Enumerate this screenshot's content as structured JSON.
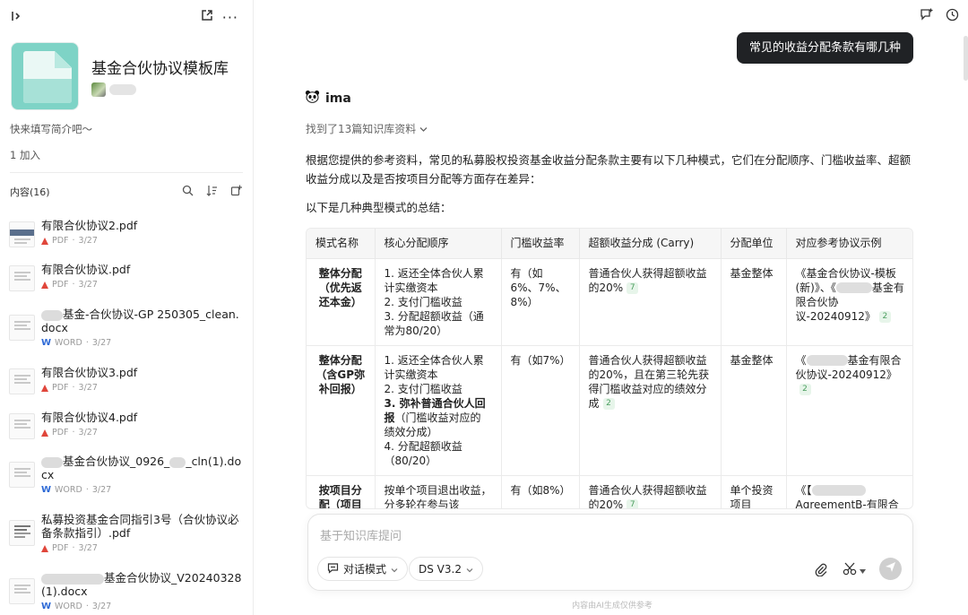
{
  "sidebar": {
    "knowledge_base_title": "基金合伙协议模板库",
    "intro_placeholder": "快来填写简介吧～",
    "members": "1 加入",
    "content_label": "内容(16)",
    "files": [
      {
        "name": "有限合伙协议2.pdf",
        "type": "PDF",
        "date": "3/27"
      },
      {
        "name": "有限合伙协议.pdf",
        "type": "PDF",
        "date": "3/27"
      },
      {
        "name_suffix": "基金-合伙协议-GP 250305_clean.docx",
        "type": "WORD",
        "date": "3/27"
      },
      {
        "name": "有限合伙协议3.pdf",
        "type": "PDF",
        "date": "3/27"
      },
      {
        "name": "有限合伙协议4.pdf",
        "type": "PDF",
        "date": "3/27"
      },
      {
        "name_part1": "基金合伙协议_0926_",
        "name_part2": "_cln(1).docx",
        "type": "WORD",
        "date": "3/27"
      },
      {
        "name": "私募投资基金合同指引3号（合伙协议必备条款指引）.pdf",
        "type": "PDF",
        "date": "3/27"
      },
      {
        "name_suffix": "基金合伙协议_V20240328(1).docx",
        "type": "WORD",
        "date": "3/27"
      }
    ]
  },
  "chat": {
    "question": "常见的收益分配条款有哪几种",
    "bot_name": "ima",
    "found_refs": "找到了13篇知识库资料",
    "answer_intro": "根据您提供的参考资料，常见的私募股权投资基金收益分配条款主要有以下几种模式，它们在分配顺序、门槛收益率、超额收益分成以及是否按项目分配等方面存在差异：",
    "summary_intro": "以下是几种典型模式的总结：",
    "table": {
      "headers": [
        "模式名称",
        "核心分配顺序",
        "门槛收益率",
        "超额收益分成 (Carry)",
        "分配单位",
        "对应参考协议示例"
      ],
      "rows": [
        {
          "name": "整体分配（优先返还本金）",
          "order": [
            "1. 返还全体合伙人累计实缴资本",
            "2. 支付门槛收益",
            "3. 分配超额收益（通常为80/20）"
          ],
          "hurdle": "有（如6%、7%、8%）",
          "carry": "普通合伙人获得超额收益的20%",
          "carry_cite": "7",
          "unit": "基金整体",
          "example_a": "《基金合伙协议-模板(新)》、《",
          "example_b": "基金有限合伙协议-20240912》",
          "example_cite": "2"
        },
        {
          "name": "整体分配（含GP弥补回报）",
          "order_1": "1. 返还全体合伙人累计实缴资本",
          "order_2": "2. 支付门槛收益",
          "order_3_bold": "3. 弥补普通合伙人回报",
          "order_3_rest": "（门槛收益对应的绩效分成）",
          "order_4": "4. 分配超额收益（80/20）",
          "hurdle": "有（如7%）",
          "carry": "普通合伙人获得超额收益的20%，且在第三轮先获得门槛收益对应的绩效分成",
          "carry_cite": "2",
          "unit": "基金整体",
          "example_a": "《",
          "example_b": "基金有限合伙协议-20240912》",
          "example_cite": "2"
        },
        {
          "name": "按项目分配（项目",
          "order": "按单个项目退出收益，分多轮在参与该",
          "hurdle": "有（如8%）",
          "carry": "普通合伙人获得超额收益的20%",
          "carry_cite": "7",
          "unit": "单个投资项目",
          "example_a": "《【",
          "example_b": "AgreementB-有限合"
        }
      ]
    }
  },
  "composer": {
    "placeholder": "基于知识库提问",
    "mode_label": "对话模式",
    "model_label": "DS V3.2"
  },
  "footer": {
    "disclaimer": "内容由AI生成仅供参考"
  }
}
